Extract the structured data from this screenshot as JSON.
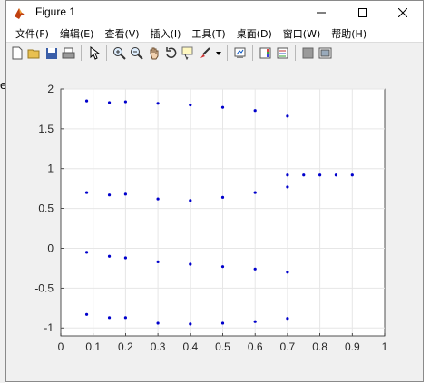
{
  "window": {
    "title": "Figure 1"
  },
  "menu": [
    "文件(F)",
    "编辑(E)",
    "查看(V)",
    "插入(I)",
    "工具(T)",
    "桌面(D)",
    "窗口(W)",
    "帮助(H)"
  ],
  "toolbar_icons": [
    "new-figure-icon",
    "open-file-icon",
    "save-icon",
    "print-icon",
    "select-arrow-icon",
    "zoom-in-icon",
    "zoom-out-icon",
    "pan-icon",
    "rotate-3d-icon",
    "data-cursor-icon",
    "brush-icon",
    "brush-dropdown-icon",
    "link-plot-icon",
    "insert-colorbar-icon",
    "insert-legend-icon",
    "hide-plot-tools-icon",
    "show-plot-tools-icon"
  ],
  "left_edge_letter": "e",
  "colors": {
    "series": "#0000cc",
    "background": "#f0f0f0",
    "axes": "#ffffff"
  },
  "chart_data": {
    "type": "scatter",
    "title": "",
    "xlabel": "",
    "ylabel": "",
    "xlim": [
      0,
      1
    ],
    "ylim": [
      -1.1,
      2
    ],
    "xticks": [
      "0",
      "0.1",
      "0.2",
      "0.3",
      "0.4",
      "0.5",
      "0.6",
      "0.7",
      "0.8",
      "0.9",
      "1"
    ],
    "yticks": [
      "2",
      "1.5",
      "1",
      "0.5",
      "0",
      "-0.5",
      "-1"
    ],
    "grid": true,
    "series": [
      {
        "values": [
          {
            "x": 0.08,
            "y": 1.85
          },
          {
            "x": 0.15,
            "y": 1.83
          },
          {
            "x": 0.2,
            "y": 1.84
          },
          {
            "x": 0.3,
            "y": 1.82
          },
          {
            "x": 0.4,
            "y": 1.8
          },
          {
            "x": 0.5,
            "y": 1.77
          },
          {
            "x": 0.6,
            "y": 1.73
          },
          {
            "x": 0.7,
            "y": 1.66
          },
          {
            "x": 0.08,
            "y": 0.7
          },
          {
            "x": 0.15,
            "y": 0.67
          },
          {
            "x": 0.2,
            "y": 0.68
          },
          {
            "x": 0.3,
            "y": 0.62
          },
          {
            "x": 0.4,
            "y": 0.6
          },
          {
            "x": 0.5,
            "y": 0.64
          },
          {
            "x": 0.6,
            "y": 0.7
          },
          {
            "x": 0.7,
            "y": 0.77
          },
          {
            "x": 0.08,
            "y": -0.05
          },
          {
            "x": 0.15,
            "y": -0.1
          },
          {
            "x": 0.2,
            "y": -0.12
          },
          {
            "x": 0.3,
            "y": -0.17
          },
          {
            "x": 0.4,
            "y": -0.2
          },
          {
            "x": 0.5,
            "y": -0.23
          },
          {
            "x": 0.6,
            "y": -0.26
          },
          {
            "x": 0.7,
            "y": -0.3
          },
          {
            "x": 0.08,
            "y": -0.83
          },
          {
            "x": 0.15,
            "y": -0.87
          },
          {
            "x": 0.2,
            "y": -0.87
          },
          {
            "x": 0.3,
            "y": -0.94
          },
          {
            "x": 0.4,
            "y": -0.95
          },
          {
            "x": 0.5,
            "y": -0.94
          },
          {
            "x": 0.6,
            "y": -0.92
          },
          {
            "x": 0.7,
            "y": -0.88
          },
          {
            "x": 0.7,
            "y": 0.92
          },
          {
            "x": 0.75,
            "y": 0.92
          },
          {
            "x": 0.8,
            "y": 0.92
          },
          {
            "x": 0.85,
            "y": 0.92
          },
          {
            "x": 0.9,
            "y": 0.92
          }
        ]
      }
    ]
  }
}
